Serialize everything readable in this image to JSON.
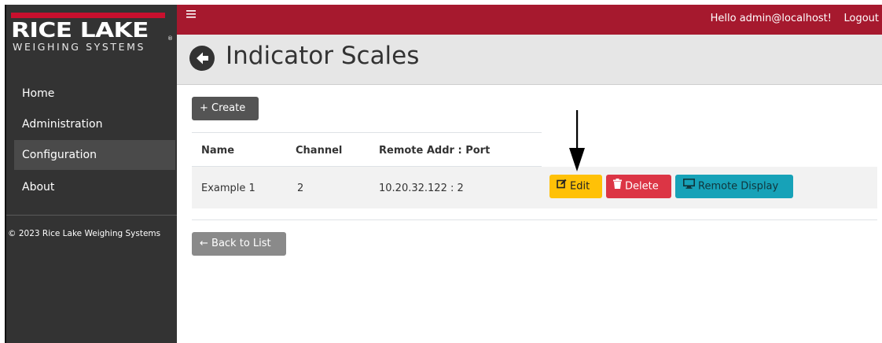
{
  "sidebar": {
    "logo": {
      "brand": "RICE LAKE",
      "tagline": "WEIGHING SYSTEMS",
      "registered": "®"
    },
    "items": [
      {
        "label": "Home",
        "active": false
      },
      {
        "label": "Administration",
        "active": false
      },
      {
        "label": "Configuration",
        "active": true
      },
      {
        "label": "About",
        "active": false
      }
    ],
    "copyright": "© 2023 Rice Lake Weighing Systems"
  },
  "topbar": {
    "menu_icon": "hamburger-icon",
    "greeting": "Hello admin@localhost!",
    "logout": "Logout"
  },
  "header": {
    "back_icon": "arrow-left-circle-icon",
    "title": "Indicator Scales"
  },
  "toolbar": {
    "create_label": "+ Create"
  },
  "table": {
    "columns": [
      "Name",
      "Channel",
      "Remote Addr : Port"
    ],
    "rows": [
      {
        "name": "Example 1",
        "channel": "2",
        "remote": "10.20.32.122 : 2"
      }
    ],
    "actions": {
      "edit_label": "Edit",
      "delete_label": "Delete",
      "remote_label": "Remote Display"
    }
  },
  "back_to_list_label": "← Back to List",
  "colors": {
    "topbar": "#a6192e",
    "sidebar": "#333333",
    "edit": "#ffc107",
    "delete": "#dc3545",
    "remote": "#17a2b8"
  }
}
